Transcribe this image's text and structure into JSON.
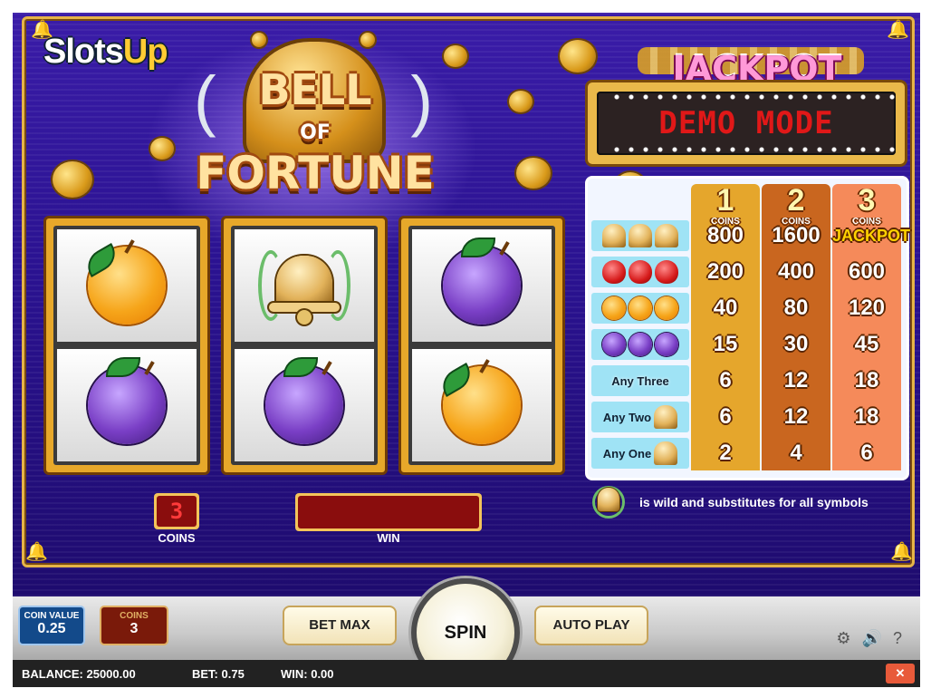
{
  "branding": {
    "logo_text_a": "Slots",
    "logo_text_b": "Up"
  },
  "title": {
    "line1": "BELL",
    "line2": "OF",
    "line3": "FORTUNE"
  },
  "jackpot": {
    "title": "JACKPOT",
    "display": "DEMO MODE"
  },
  "reels": [
    {
      "top": "orange",
      "bottom": "plum"
    },
    {
      "top": "bell",
      "bottom": "plum"
    },
    {
      "top": "plum",
      "bottom": "orange"
    }
  ],
  "paytable": {
    "headers": [
      {
        "num": "1",
        "label": "COINS"
      },
      {
        "num": "2",
        "label": "COINS"
      },
      {
        "num": "3",
        "label": "COINS"
      }
    ],
    "rows": [
      {
        "symbols": "bell x3",
        "label": "",
        "values": [
          "800",
          "1600",
          "JACKPOT"
        ]
      },
      {
        "symbols": "strawberry x3",
        "label": "",
        "values": [
          "200",
          "400",
          "600"
        ]
      },
      {
        "symbols": "orange x3",
        "label": "",
        "values": [
          "40",
          "80",
          "120"
        ]
      },
      {
        "symbols": "plum x3",
        "label": "",
        "values": [
          "15",
          "30",
          "45"
        ]
      },
      {
        "symbols": "mixed fruit",
        "label": "Any Three",
        "values": [
          "6",
          "12",
          "18"
        ]
      },
      {
        "symbols": "bell",
        "label": "Any Two",
        "values": [
          "6",
          "12",
          "18"
        ]
      },
      {
        "symbols": "bell",
        "label": "Any One",
        "values": [
          "2",
          "4",
          "6"
        ]
      }
    ]
  },
  "coins_display": {
    "value": "3",
    "label": "COINS"
  },
  "win_display": {
    "label": "WIN"
  },
  "wild_note": "is wild and substitutes for all symbols",
  "controls": {
    "coin_value_label": "COIN VALUE",
    "coin_value": "0.25",
    "coins_label": "COINS",
    "coins_value": "3",
    "bet_max": "BET MAX",
    "spin": "SPIN",
    "auto_play": "AUTO PLAY"
  },
  "status": {
    "balance": "BALANCE: 25000.00",
    "bet": "BET: 0.75",
    "win": "WIN: 0.00",
    "close_glyph": "✕"
  }
}
